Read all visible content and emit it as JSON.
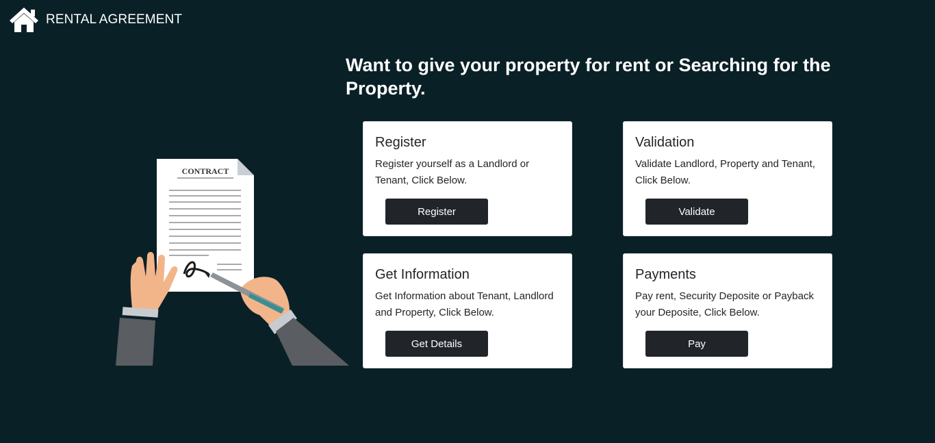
{
  "brand": {
    "title": "RENTAL AGREEMENT",
    "icon": "house-icon"
  },
  "headline": "Want to give your property for rent or Searching for the Property.",
  "illustration": {
    "contract_label": "CONTRACT"
  },
  "cards": [
    {
      "title": "Register",
      "text": "Register yourself as a Landlord or Tenant, Click Below.",
      "button": "Register"
    },
    {
      "title": "Validation",
      "text": "Validate Landlord, Property and Tenant, Click Below.",
      "button": "Validate"
    },
    {
      "title": "Get Information",
      "text": "Get Information about Tenant, Landlord and Property, Click Below.",
      "button": "Get Details"
    },
    {
      "title": "Payments",
      "text": "Pay rent, Security Deposite or Payback your Deposite, Click Below.",
      "button": "Pay"
    }
  ],
  "colors": {
    "background": "#0a2027",
    "card": "#ffffff",
    "button": "#212429"
  }
}
